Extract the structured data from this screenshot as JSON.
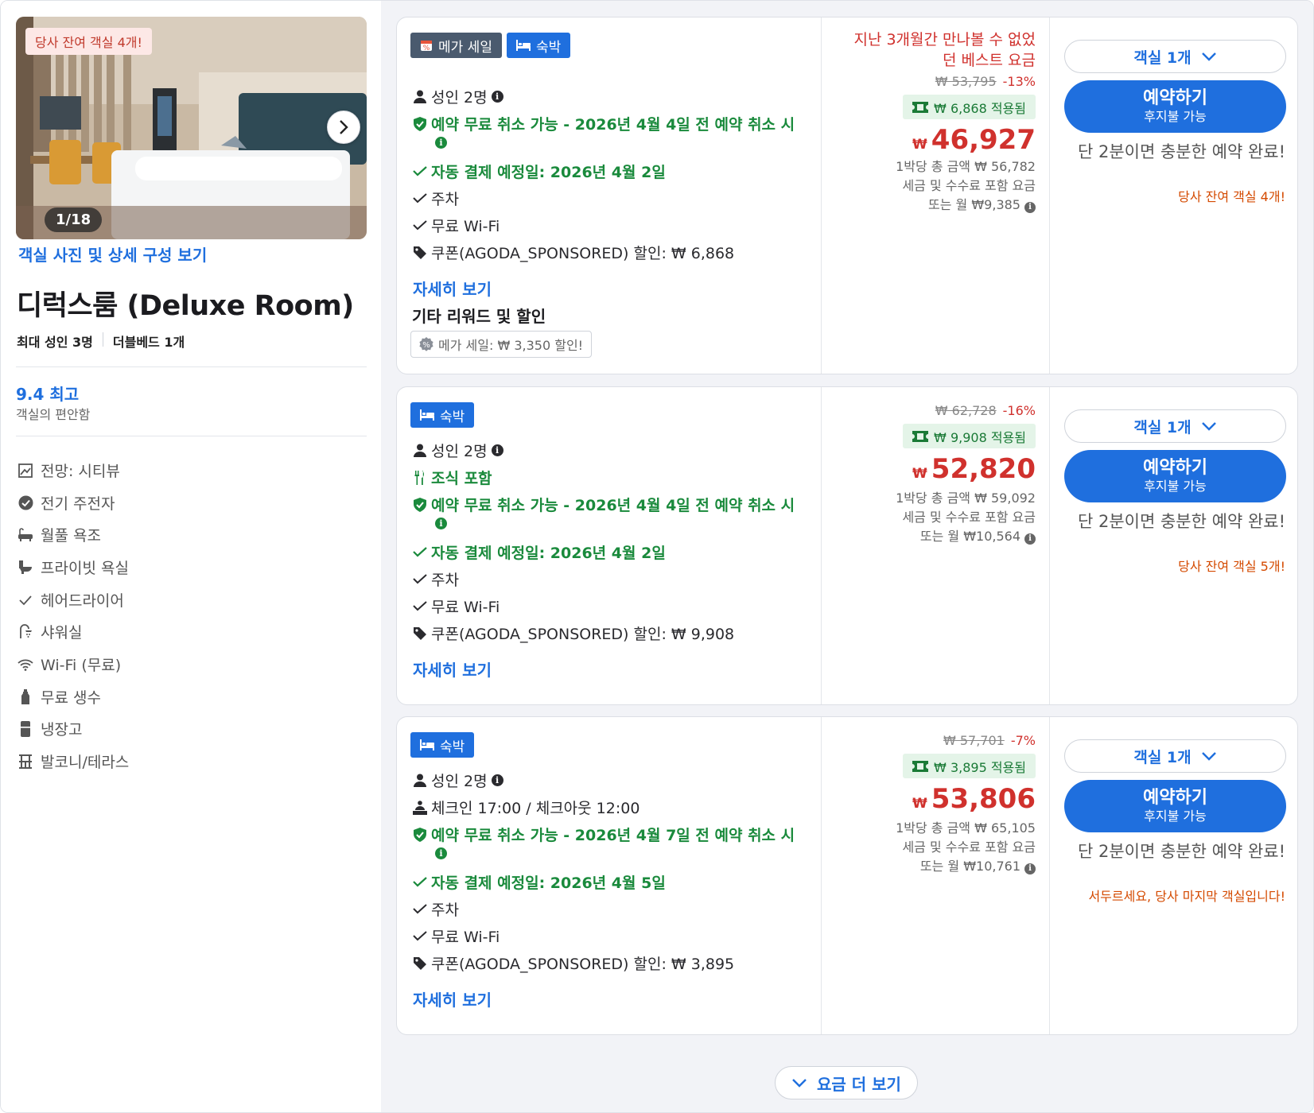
{
  "room": {
    "urgent_tag": "당사 잔여 객실 4개!",
    "photo_counter": "1/18",
    "photo_link": "객실 사진 및 상세 구성 보기",
    "title": "디럭스룸 (Deluxe Room)",
    "max_adults": "최대 성인 3명",
    "bed": "더블베드 1개",
    "score": "9.4 최고",
    "score_label": "객실의 편안함",
    "amenities": [
      {
        "label": "전망: 시티뷰",
        "icon": "view-icon"
      },
      {
        "label": "전기 주전자",
        "icon": "check-circle-icon"
      },
      {
        "label": "월풀 욕조",
        "icon": "bathtub-icon"
      },
      {
        "label": "프라이빗 욕실",
        "icon": "toilet-icon"
      },
      {
        "label": "헤어드라이어",
        "icon": "check-icon"
      },
      {
        "label": "샤워실",
        "icon": "shower-icon"
      },
      {
        "label": "Wi-Fi (무료)",
        "icon": "wifi-icon"
      },
      {
        "label": "무료 생수",
        "icon": "water-bottle-icon"
      },
      {
        "label": "냉장고",
        "icon": "fridge-icon"
      },
      {
        "label": "발코니/테라스",
        "icon": "balcony-icon"
      }
    ]
  },
  "offers": [
    {
      "badges": {
        "mega": "메가 세일",
        "stay": "숙박"
      },
      "adults": "성인 2명",
      "cancel": "예약 무료 취소 가능 - 2026년 4월 4일 전 예약 취소 시",
      "autopay": "자동 결제 예정일: 2026년 4월 2일",
      "parking": "주차",
      "wifi": "무료 Wi-Fi",
      "coupon": "쿠폰(AGODA_SPONSORED) 할인: ₩ 6,868",
      "more": "자세히 보기",
      "extra_title": "기타 리워드 및 할인",
      "extra_chip": "메가 세일: ₩ 3,350 할인!",
      "best_line1": "지난 3개월간 만나볼 수 없었",
      "best_line2": "던 베스트 요금",
      "orig_price": "₩ 53,795",
      "discount_pct": "-13%",
      "coupon_applied": "₩ 6,868 적용됨",
      "currency": "₩",
      "price": "46,927",
      "total": "1박당 총 금액 ₩ 56,782",
      "tax_note": "세금 및 수수료 포함 요금",
      "monthly": "또는 월 ₩9,385",
      "room_select": "객실 1개",
      "book": "예약하기",
      "pay_later": "후지불 가능",
      "quick": "단 2분이면 충분한 예약 완료!",
      "rooms_left": "당사 잔여 객실 4개!"
    },
    {
      "badges": {
        "stay": "숙박"
      },
      "adults": "성인 2명",
      "breakfast": "조식 포함",
      "cancel": "예약 무료 취소 가능 - 2026년 4월 4일 전 예약 취소 시",
      "autopay": "자동 결제 예정일: 2026년 4월 2일",
      "parking": "주차",
      "wifi": "무료 Wi-Fi",
      "coupon": "쿠폰(AGODA_SPONSORED) 할인: ₩ 9,908",
      "more": "자세히 보기",
      "orig_price": "₩ 62,728",
      "discount_pct": "-16%",
      "coupon_applied": "₩ 9,908 적용됨",
      "currency": "₩",
      "price": "52,820",
      "total": "1박당 총 금액 ₩ 59,092",
      "tax_note": "세금 및 수수료 포함 요금",
      "monthly": "또는 월 ₩10,564",
      "room_select": "객실 1개",
      "book": "예약하기",
      "pay_later": "후지불 가능",
      "quick": "단 2분이면 충분한 예약 완료!",
      "rooms_left": "당사 잔여 객실 5개!"
    },
    {
      "badges": {
        "stay": "숙박"
      },
      "adults": "성인 2명",
      "checkin": "체크인 17:00 / 체크아웃 12:00",
      "cancel": "예약 무료 취소 가능 - 2026년 4월 7일 전 예약 취소 시",
      "autopay": "자동 결제 예정일: 2026년 4월 5일",
      "parking": "주차",
      "wifi": "무료 Wi-Fi",
      "coupon": "쿠폰(AGODA_SPONSORED) 할인: ₩ 3,895",
      "more": "자세히 보기",
      "orig_price": "₩ 57,701",
      "discount_pct": "-7%",
      "coupon_applied": "₩ 3,895 적용됨",
      "currency": "₩",
      "price": "53,806",
      "total": "1박당 총 금액 ₩ 65,105",
      "tax_note": "세금 및 수수료 포함 요금",
      "monthly": "또는 월 ₩10,761",
      "room_select": "객실 1개",
      "book": "예약하기",
      "pay_later": "후지불 가능",
      "quick": "단 2분이면 충분한 예약 완료!",
      "rooms_left": "서두르세요, 당사 마지막 객실입니다!"
    }
  ],
  "show_more": "요금 더 보기",
  "colors": {
    "accent": "#1f6fde",
    "price": "#d0312d",
    "green": "#1a8a3c",
    "urgent": "#d44a00"
  }
}
